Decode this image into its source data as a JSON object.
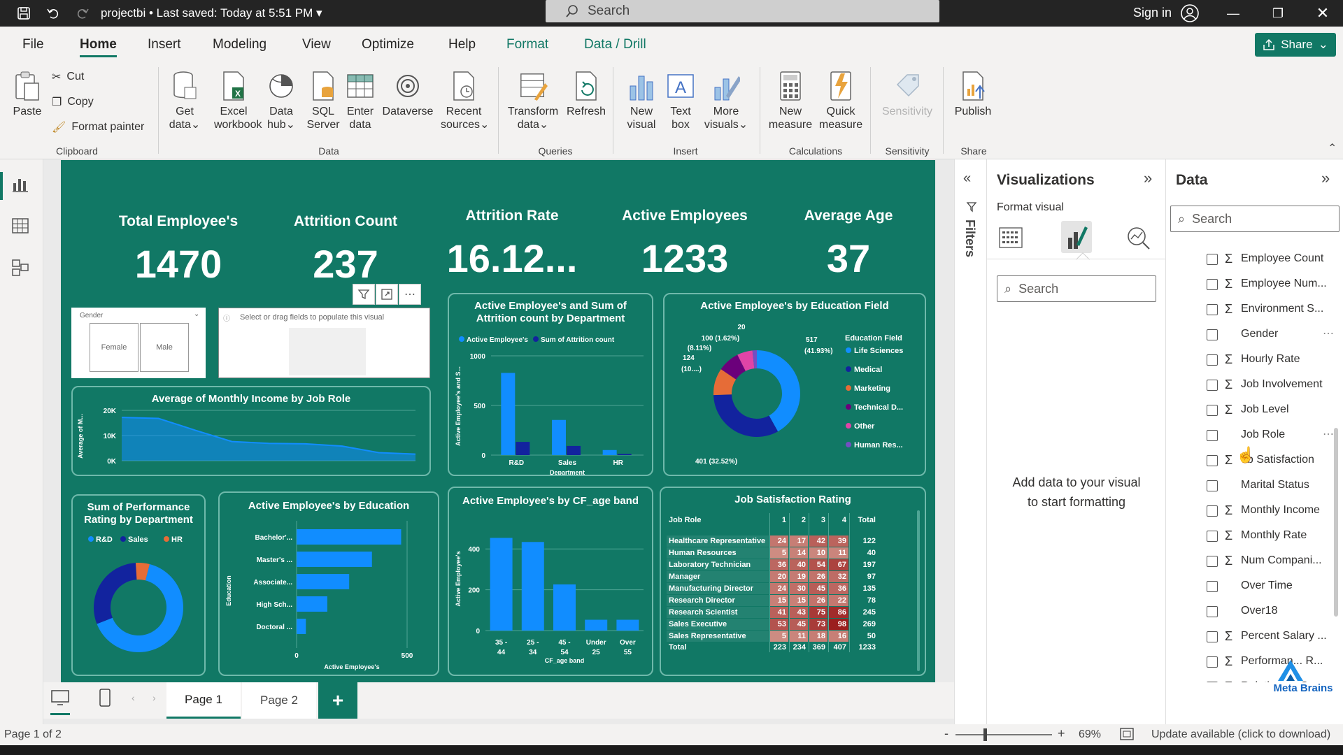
{
  "titlebar": {
    "file_title": "projectbi • Last saved: Today at 5:51 PM",
    "search_placeholder": "Search",
    "sign_in": "Sign in"
  },
  "menu": {
    "tabs": [
      "File",
      "Home",
      "Insert",
      "Modeling",
      "View",
      "Optimize",
      "Help",
      "Format",
      "Data / Drill"
    ],
    "active": "Home",
    "share": "Share"
  },
  "ribbon": {
    "clipboard": {
      "paste": "Paste",
      "cut": "Cut",
      "copy": "Copy",
      "format_painter": "Format painter",
      "label": "Clipboard"
    },
    "data": {
      "get_data": "Get data",
      "excel": "Excel workbook",
      "data_hub": "Data hub",
      "sql": "SQL Server",
      "enter_data": "Enter data",
      "dataverse": "Dataverse",
      "recent": "Recent sources",
      "label": "Data"
    },
    "queries": {
      "transform": "Transform data",
      "refresh": "Refresh",
      "label": "Queries"
    },
    "insert": {
      "new_visual": "New visual",
      "text_box": "Text box",
      "more_visuals": "More visuals",
      "label": "Insert"
    },
    "calculations": {
      "new_measure": "New measure",
      "quick_measure": "Quick measure",
      "label": "Calculations"
    },
    "sensitivity": {
      "sensitivity": "Sensitivity",
      "label": "Sensitivity"
    },
    "share": {
      "publish": "Publish",
      "label": "Share"
    }
  },
  "report": {
    "kpis": [
      {
        "title": "Total Employee's",
        "value": "1470"
      },
      {
        "title": "Attrition Count",
        "value": "237"
      },
      {
        "title": "Attrition Rate",
        "value": "16.12..."
      },
      {
        "title": "Active Employees",
        "value": "1233"
      },
      {
        "title": "Average Age",
        "value": "37"
      }
    ],
    "slicer": {
      "title": "Gender",
      "options": [
        "Female",
        "Male"
      ]
    },
    "placeholder_visual": {
      "text": "Select or drag fields to populate this visual"
    },
    "income_chart": {
      "title": "Average of Monthly Income by Job Role",
      "ylabel": "Average of M...",
      "ticks": [
        "20K",
        "10K",
        "0K"
      ]
    },
    "dept_chart": {
      "title_line1": "Active Employee's and Sum of",
      "title_line2": "Attrition count by Department",
      "legend": [
        "Active Employee's",
        "Sum of Attrition count"
      ],
      "ylabel": "Active Employee's and S...",
      "xlabel": "Department",
      "ticks": [
        "1000",
        "500",
        "0"
      ],
      "categories": [
        "R&D",
        "Sales",
        "HR"
      ]
    },
    "edu_field_chart": {
      "title": "Active Employee's by Education Field",
      "legend_title": "Education Field",
      "legend": [
        "Life Sciences",
        "Medical",
        "Marketing",
        "Technical D...",
        "Other",
        "Human Res..."
      ],
      "labels": [
        "20",
        "100 (1.62%)",
        "(8.11%)",
        "124",
        "(10....)",
        "517",
        "(41.93%)",
        "401 (32.52%)"
      ]
    },
    "perf_chart": {
      "title_line1": "Sum of Performance",
      "title_line2": "Rating by Department",
      "legend": [
        "R&D",
        "Sales",
        "HR"
      ]
    },
    "education_chart": {
      "title": "Active Employee's by Education",
      "ylabel": "Education",
      "xlabel": "Active Employee's",
      "categories": [
        "Bachelor'...",
        "Master's ...",
        "Associate...",
        "High Sch...",
        "Doctoral ..."
      ],
      "ticks": [
        "0",
        "500"
      ]
    },
    "age_chart": {
      "title": "Active Employee's by CF_age band",
      "ylabel": "Active Employee's",
      "xlabel": "CF_age band",
      "ticks": [
        "400",
        "200",
        "0"
      ],
      "categories": [
        [
          "35 -",
          "44"
        ],
        [
          "25 -",
          "34"
        ],
        [
          "45 -",
          "54"
        ],
        [
          "Under",
          "25"
        ],
        [
          "Over",
          "55"
        ]
      ]
    },
    "job_sat": {
      "title": "Job Satisfaction Rating",
      "headers": [
        "Job Role",
        "1",
        "2",
        "3",
        "4",
        "Total"
      ],
      "rows": [
        [
          "Healthcare Representative",
          "24",
          "17",
          "42",
          "39",
          "122"
        ],
        [
          "Human Resources",
          "5",
          "14",
          "10",
          "11",
          "40"
        ],
        [
          "Laboratory Technician",
          "36",
          "40",
          "54",
          "67",
          "197"
        ],
        [
          "Manager",
          "20",
          "19",
          "26",
          "32",
          "97"
        ],
        [
          "Manufacturing Director",
          "24",
          "30",
          "45",
          "36",
          "135"
        ],
        [
          "Research Director",
          "15",
          "15",
          "26",
          "22",
          "78"
        ],
        [
          "Research Scientist",
          "41",
          "43",
          "75",
          "86",
          "245"
        ],
        [
          "Sales Executive",
          "53",
          "45",
          "73",
          "98",
          "269"
        ],
        [
          "Sales Representative",
          "5",
          "11",
          "18",
          "16",
          "50"
        ]
      ],
      "total": [
        "Total",
        "223",
        "234",
        "369",
        "407",
        "1233"
      ]
    }
  },
  "chart_data": [
    {
      "type": "bar",
      "title": "Active Employee's and Sum of Attrition count by Department",
      "categories": [
        "R&D",
        "Sales",
        "HR"
      ],
      "series": [
        {
          "name": "Active Employee's",
          "values": [
            828,
            354,
            51
          ]
        },
        {
          "name": "Sum of Attrition count",
          "values": [
            133,
            92,
            12
          ]
        }
      ],
      "ylim": [
        0,
        1000
      ]
    },
    {
      "type": "pie",
      "title": "Active Employee's by Education Field",
      "categories": [
        "Life Sciences",
        "Medical",
        "Marketing",
        "Technical D...",
        "Other",
        "Human Res..."
      ],
      "values": [
        517,
        401,
        124,
        100,
        71,
        20
      ]
    },
    {
      "type": "pie",
      "title": "Sum of Performance Rating by Department",
      "categories": [
        "R&D",
        "Sales",
        "HR"
      ],
      "values": [
        65,
        30,
        5
      ]
    },
    {
      "type": "bar",
      "title": "Active Employee's by Education",
      "categories": [
        "Bachelor'...",
        "Master's ...",
        "Associate...",
        "High Sch...",
        "Doctoral ..."
      ],
      "values": [
        473,
        341,
        238,
        139,
        42
      ],
      "xlim": [
        0,
        500
      ]
    },
    {
      "type": "bar",
      "title": "Active Employee's by CF_age band",
      "categories": [
        "35 - 44",
        "25 - 34",
        "45 - 54",
        "Under 25",
        "Over 55"
      ],
      "values": [
        454,
        434,
        226,
        53,
        53
      ],
      "ylim": [
        0,
        500
      ]
    },
    {
      "type": "area",
      "title": "Average of Monthly Income by Job Role",
      "values": [
        17200,
        16800,
        12100,
        7600,
        6900,
        6700,
        5800,
        3200,
        2600
      ],
      "ylim": [
        0,
        20000
      ]
    }
  ],
  "viz_pane": {
    "title": "Visualizations",
    "subtitle": "Format visual",
    "search_placeholder": "Search",
    "empty_message_1": "Add data to your visual",
    "empty_message_2": "to start formatting"
  },
  "filters": {
    "label": "Filters"
  },
  "data_pane": {
    "title": "Data",
    "search_placeholder": "Search",
    "fields": [
      {
        "name": "Employee Count",
        "sigma": true
      },
      {
        "name": "Employee Num...",
        "sigma": true
      },
      {
        "name": "Environment S...",
        "sigma": true
      },
      {
        "name": "Gender",
        "sigma": false
      },
      {
        "name": "Hourly Rate",
        "sigma": true
      },
      {
        "name": "Job Involvement",
        "sigma": true
      },
      {
        "name": "Job Level",
        "sigma": true
      },
      {
        "name": "Job Role",
        "sigma": false
      },
      {
        "name": "ob Satisfaction",
        "sigma": true
      },
      {
        "name": "Marital Status",
        "sigma": false
      },
      {
        "name": "Monthly Income",
        "sigma": true
      },
      {
        "name": "Monthly Rate",
        "sigma": true
      },
      {
        "name": "Num Compani...",
        "sigma": true
      },
      {
        "name": "Over Time",
        "sigma": false
      },
      {
        "name": "Over18",
        "sigma": false
      },
      {
        "name": "Percent Salary ...",
        "sigma": true
      },
      {
        "name": "Performan... R...",
        "sigma": true
      },
      {
        "name": "Relation...p Sa...",
        "sigma": true
      }
    ]
  },
  "pages": {
    "tabs": [
      "Page 1",
      "Page 2"
    ],
    "active": "Page 1",
    "add": "+"
  },
  "status": {
    "page": "Page 1 of 2",
    "zoom": "69%",
    "update": "Update available (click to download)",
    "minus": "-",
    "plus": "+"
  },
  "watermark": {
    "brand": "Meta Brains"
  },
  "colors": {
    "teal": "#117865",
    "blue": "#118dff",
    "navy": "#12239e",
    "orange": "#e66c37",
    "purple": "#6b007b",
    "magenta": "#e044a7",
    "violet": "#744ec2"
  }
}
